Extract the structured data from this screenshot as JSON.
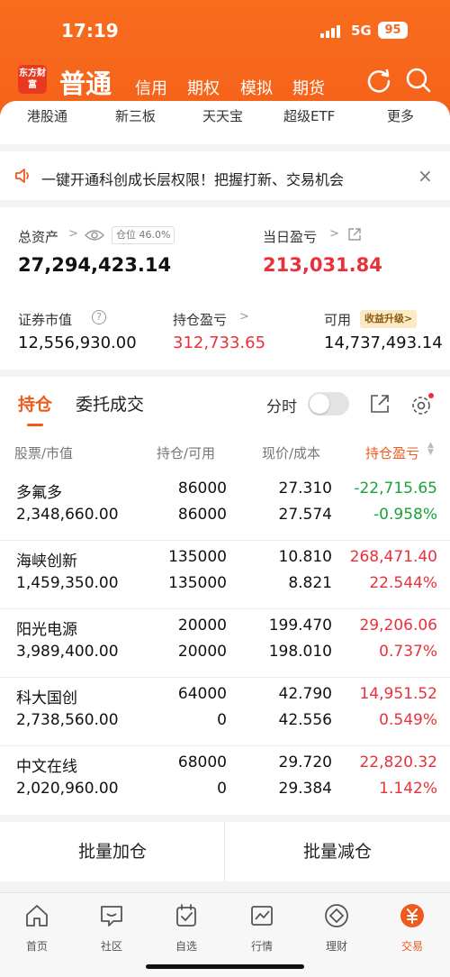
{
  "status": {
    "time": "17:19",
    "network": "5G",
    "battery": "95"
  },
  "header": {
    "logo": "东方财富",
    "main_tab": "普通",
    "tabs": [
      "信用",
      "期权",
      "模拟",
      "期货"
    ]
  },
  "subnav": [
    "港股通",
    "新三板",
    "天天宝",
    "超级ETF",
    "更多"
  ],
  "notice": {
    "text": "一键开通科创成长层权限！把握打新、交易机会",
    "close": "×"
  },
  "assets": {
    "total_label": "总资产",
    "position_badge": "仓位",
    "position_pct": "46.0%",
    "total_value": "27,294,423.14",
    "daily_label": "当日盈亏",
    "daily_value": "213,031.84",
    "market_label": "证券市值",
    "market_value": "12,556,930.00",
    "hold_pl_label": "持仓盈亏",
    "hold_pl_value": "312,733.65",
    "available_label": "可用",
    "available_badge": "收益升级>",
    "available_value": "14,737,493.14"
  },
  "holdings": {
    "tab_active": "持仓",
    "tab_other": "委托成交",
    "fenshi": "分时",
    "columns": [
      "股票/市值",
      "持仓/可用",
      "现价/成本",
      "持仓盈亏"
    ],
    "rows": [
      {
        "name": "多氟多",
        "mv": "2,348,660.00",
        "hold": "86000",
        "avail": "86000",
        "price": "27.310",
        "cost": "27.574",
        "pl": "-22,715.65",
        "pct": "-0.958%",
        "up": false
      },
      {
        "name": "海峡创新",
        "mv": "1,459,350.00",
        "hold": "135000",
        "avail": "135000",
        "price": "10.810",
        "cost": "8.821",
        "pl": "268,471.40",
        "pct": "22.544%",
        "up": true
      },
      {
        "name": "阳光电源",
        "mv": "3,989,400.00",
        "hold": "20000",
        "avail": "20000",
        "price": "199.470",
        "cost": "198.010",
        "pl": "29,206.06",
        "pct": "0.737%",
        "up": true
      },
      {
        "name": "科大国创",
        "mv": "2,738,560.00",
        "hold": "64000",
        "avail": "0",
        "price": "42.790",
        "cost": "42.556",
        "pl": "14,951.52",
        "pct": "0.549%",
        "up": true
      },
      {
        "name": "中文在线",
        "mv": "2,020,960.00",
        "hold": "68000",
        "avail": "0",
        "price": "29.720",
        "cost": "29.384",
        "pl": "22,820.32",
        "pct": "1.142%",
        "up": true
      }
    ]
  },
  "actions": {
    "add": "批量加仓",
    "reduce": "批量减仓"
  },
  "tabbar": [
    "首页",
    "社区",
    "自选",
    "行情",
    "理财",
    "交易"
  ],
  "colors": {
    "brand": "#f5621a",
    "up": "#e8313b",
    "down": "#1aa33a"
  }
}
